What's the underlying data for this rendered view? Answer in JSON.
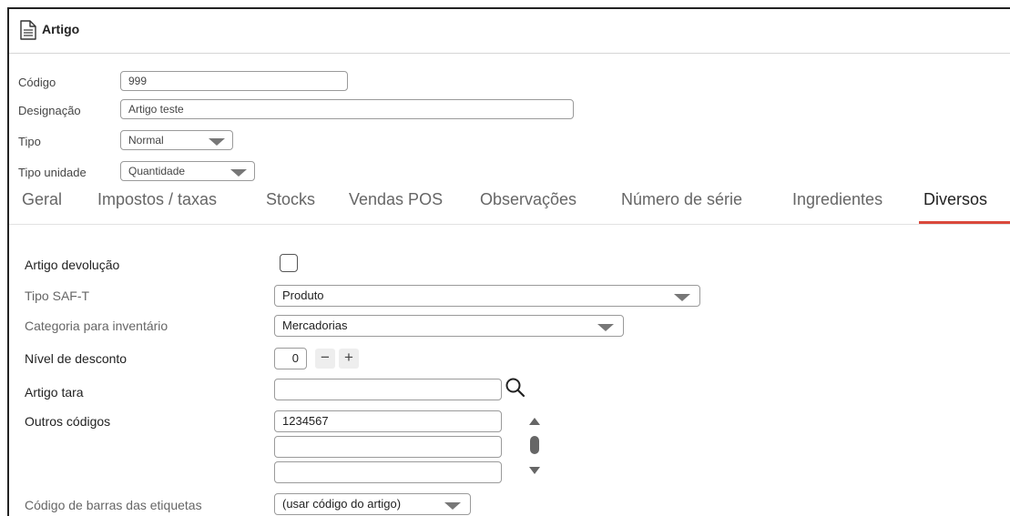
{
  "window": {
    "title": "Artigo",
    "icon": "document-icon"
  },
  "header_form": {
    "codigo": {
      "label": "Código",
      "value": "999"
    },
    "designacao": {
      "label": "Designação",
      "value": "Artigo teste"
    },
    "tipo": {
      "label": "Tipo",
      "value": "Normal"
    },
    "tipo_unidade": {
      "label": "Tipo unidade",
      "value": "Quantidade"
    }
  },
  "tabs": [
    {
      "label": "Geral"
    },
    {
      "label": "Impostos / taxas"
    },
    {
      "label": "Stocks"
    },
    {
      "label": "Vendas POS"
    },
    {
      "label": "Observações"
    },
    {
      "label": "Número de série"
    },
    {
      "label": "Ingredientes"
    },
    {
      "label": "Diversos",
      "active": true
    }
  ],
  "diversos": {
    "artigo_devolucao": {
      "label": "Artigo devolução",
      "checked": false
    },
    "tipo_saft": {
      "label": "Tipo SAF-T",
      "value": "Produto"
    },
    "categoria_inventario": {
      "label": "Categoria para inventário",
      "value": "Mercadorias"
    },
    "nivel_desconto": {
      "label": "Nível de desconto",
      "value": "0",
      "minus": "−",
      "plus": "+"
    },
    "artigo_tara": {
      "label": "Artigo tara",
      "value": ""
    },
    "outros_codigos": {
      "label": "Outros códigos",
      "values": [
        "1234567",
        "",
        ""
      ]
    },
    "codigo_barras": {
      "label": "Código de barras das etiquetas",
      "value": "(usar código do artigo)"
    }
  },
  "colors": {
    "accent": "#d9483b"
  }
}
